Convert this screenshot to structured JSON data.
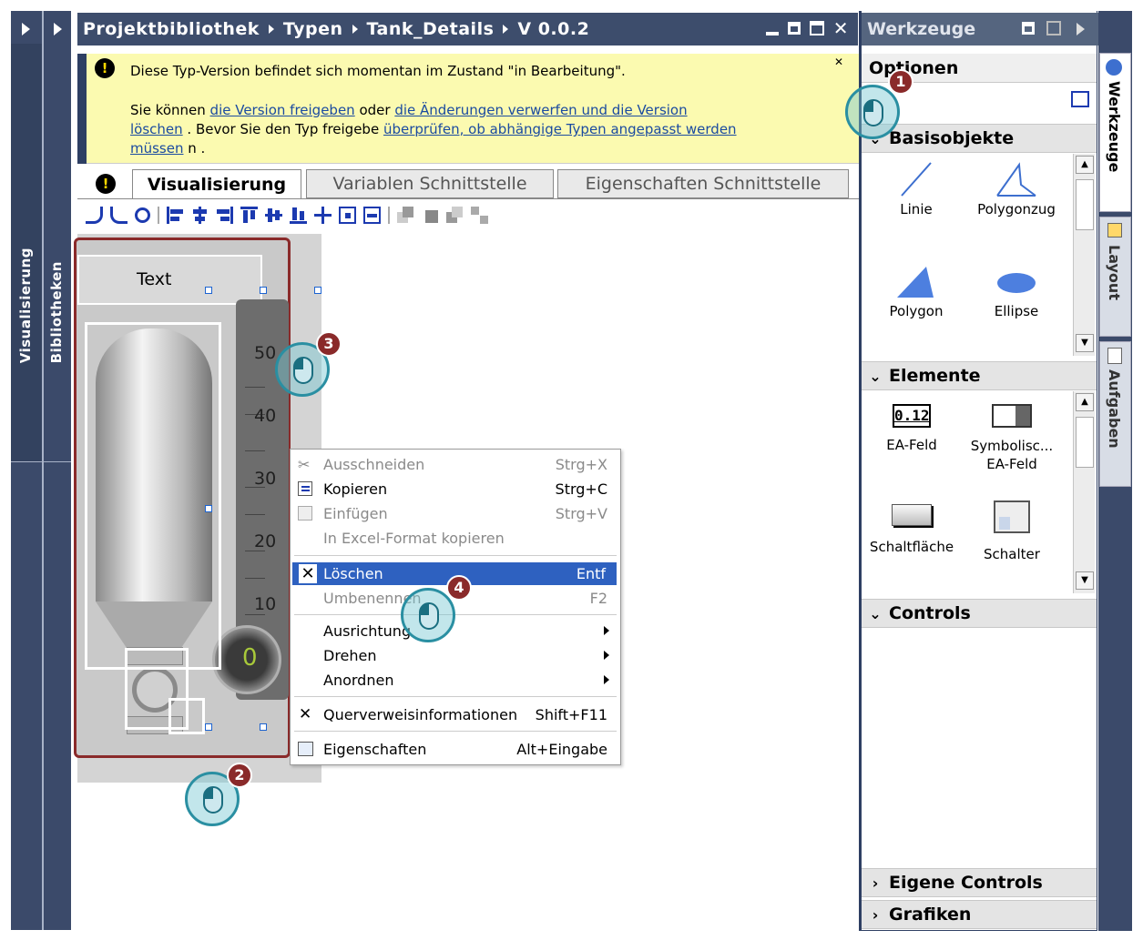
{
  "left_rail": {
    "tab1": "Visualisierung",
    "tab2": "Bibliotheken"
  },
  "header": {
    "breadcrumb": [
      "Projektbibliothek",
      "Typen",
      "Tank_Details",
      "V 0.0.2"
    ]
  },
  "warning": {
    "line1": "Diese Typ-Version befindet sich momentan im Zustand \"in Bearbeitung\".",
    "p2_a": "Sie können ",
    "link_release": "die Version freigeben",
    "p2_b": " oder ",
    "link_discard_1": "die Änderungen verwerfen und die Version",
    "link_discard_2": "löschen",
    "p2_c": " . Bevor Sie den Typ freigebe ",
    "link_check_1": "überprüfen, ob abhängige Typen angepasst werden",
    "link_check_2": "müssen",
    "p2_d": " n ."
  },
  "tabs": [
    "Visualisierung",
    "Variablen Schnittstelle",
    "Eigenschaften Schnittstelle"
  ],
  "canvas": {
    "text_label": "Text",
    "scale": [
      "50",
      "40",
      "30",
      "20",
      "10"
    ],
    "gauge_value": "0"
  },
  "context_menu": {
    "items": [
      {
        "label": "Ausschneiden",
        "shortcut": "Strg+X",
        "state": "disabled"
      },
      {
        "label": "Kopieren",
        "shortcut": "Strg+C",
        "state": "enabled"
      },
      {
        "label": "Einfügen",
        "shortcut": "Strg+V",
        "state": "disabled"
      },
      {
        "label": "In Excel-Format kopieren",
        "shortcut": "",
        "state": "disabled"
      },
      {
        "label": "Löschen",
        "shortcut": "Entf",
        "state": "selected"
      },
      {
        "label": "Umbenennen",
        "shortcut": "F2",
        "state": "disabled"
      },
      {
        "label": "Ausrichtung",
        "shortcut": "",
        "state": "enabled"
      },
      {
        "label": "Drehen",
        "shortcut": "",
        "state": "enabled"
      },
      {
        "label": "Anordnen",
        "shortcut": "",
        "state": "enabled"
      },
      {
        "label": "Querverweisinformationen",
        "shortcut": "Shift+F11",
        "state": "enabled"
      },
      {
        "label": "Eigenschaften",
        "shortcut": "Alt+Eingabe",
        "state": "enabled"
      }
    ]
  },
  "tools": {
    "title": "Werkzeuge",
    "options": "Optionen",
    "basis": "Basisobjekte",
    "basis_items": [
      "Linie",
      "Polygonzug",
      "Polygon",
      "Ellipse"
    ],
    "elemente": "Elemente",
    "elemente_items": [
      "EA-Feld",
      "Symbolisc... EA-Feld",
      "Schaltfläche",
      "Schalter"
    ],
    "ea_sample": "0.12",
    "controls": "Controls",
    "eigene": "Eigene Controls",
    "grafiken": "Grafiken"
  },
  "right_rail": [
    "Werkzeuge",
    "Layout",
    "Aufgaben"
  ],
  "callouts": [
    "1",
    "2",
    "3",
    "4"
  ]
}
